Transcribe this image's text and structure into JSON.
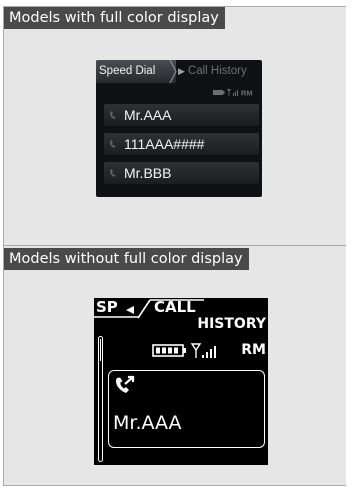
{
  "sections": {
    "full_color": {
      "header": "Models with full color display",
      "tabs": {
        "active": "Speed Dial",
        "inactive": "Call History"
      },
      "status_text": "RM",
      "entries": [
        "Mr.AAA",
        "111AAA####",
        "Mr.BBB"
      ]
    },
    "mono": {
      "header": "Models without full color display",
      "tab_left": "SP",
      "tab_right_line1": "CALL",
      "tab_right_line2": "HISTORY",
      "status_text": "RM",
      "selected_entry": "Mr.AAA"
    }
  },
  "colors": {
    "panel_bg": "#e6e6e6",
    "header_bg": "#4a4a4a",
    "header_text": "#ffffff",
    "screen_bg": "#101114"
  },
  "icons": [
    "handset-icon",
    "battery-icon",
    "signal-icon",
    "outgoing-call-icon",
    "chevron-left-icon",
    "chevron-right-icon"
  ]
}
